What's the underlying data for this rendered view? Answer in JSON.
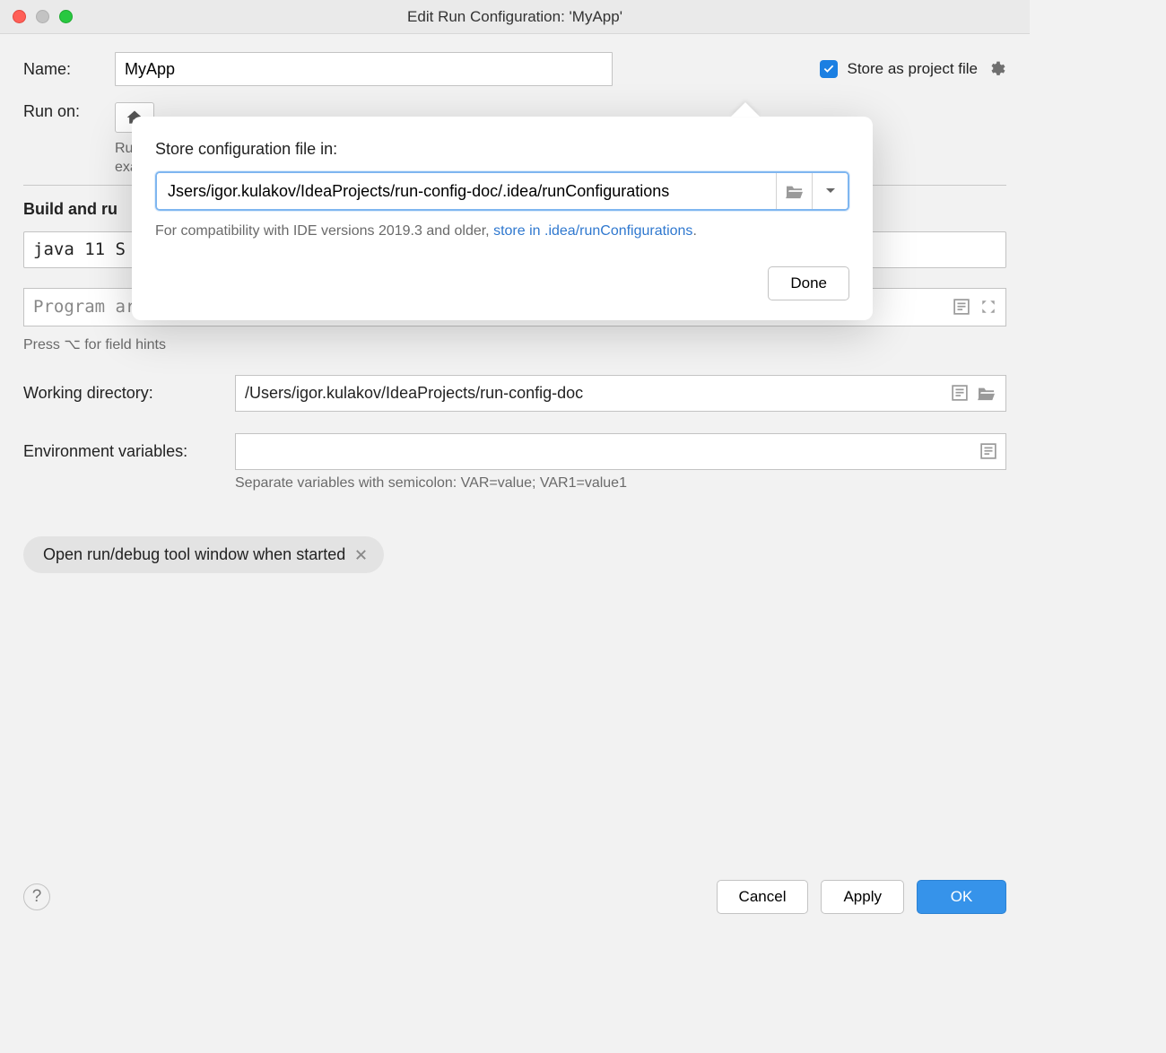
{
  "window": {
    "title": "Edit Run Configuration: 'MyApp'"
  },
  "name": {
    "label": "Name:",
    "value": "MyApp"
  },
  "store": {
    "label": "Store as project file",
    "checked": true
  },
  "runon": {
    "label": "Run on:",
    "helper_partial": "Ru...\nexa..."
  },
  "buildrun": {
    "section_title_partial": "Build and ru",
    "jdk_partial": "java 11 S",
    "program_args_placeholder": "Program arguments",
    "hint": "Press ⌥ for field hints"
  },
  "working_dir": {
    "label": "Working directory:",
    "value": "/Users/igor.kulakov/IdeaProjects/run-config-doc"
  },
  "env": {
    "label": "Environment variables:",
    "value": "",
    "helper": "Separate variables with semicolon: VAR=value; VAR1=value1"
  },
  "chip": {
    "label": "Open run/debug tool window when started"
  },
  "footer": {
    "cancel": "Cancel",
    "apply": "Apply",
    "ok": "OK"
  },
  "popover": {
    "title": "Store configuration file in:",
    "path": "Jsers/igor.kulakov/IdeaProjects/run-config-doc/.idea/runConfigurations",
    "compat_text": "For compatibility with IDE versions 2019.3 and older, ",
    "compat_link": "store in .idea/runConfigurations",
    "compat_suffix": ".",
    "done": "Done"
  }
}
